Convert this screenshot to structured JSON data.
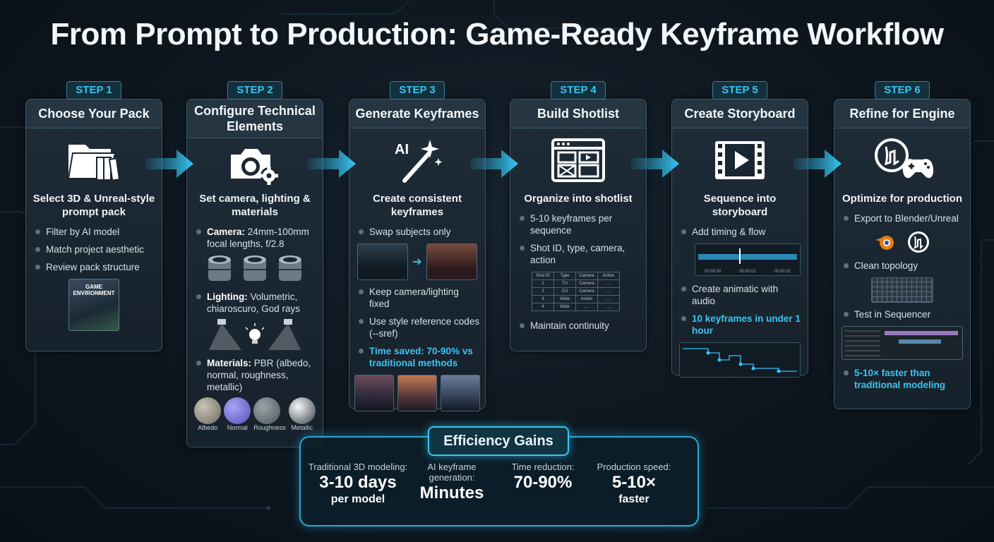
{
  "title": "From Prompt to Production: Game-Ready Keyframe Workflow",
  "colors": {
    "accent": "#38c6f2",
    "card": "#1a2632",
    "border": "#3b5466"
  },
  "steps": [
    {
      "badge": "STEP 1",
      "heading": "Choose Your Pack",
      "icon": "folder-icon",
      "subheading": "Select 3D & Unreal-style prompt pack",
      "bullets": [
        "Filter by AI model",
        "Match project aesthetic",
        "Review pack structure"
      ],
      "pack_cover_title": "GAME ENVIRONMENT"
    },
    {
      "badge": "STEP 2",
      "heading": "Configure Technical Elements",
      "icon": "camera-gear-icon",
      "subheading": "Set camera, lighting & materials",
      "camera_label": "Camera:",
      "camera_text": "24mm-100mm focal lengths, f/2.8",
      "lighting_label": "Lighting:",
      "lighting_text": "Volumetric, chiaroscuro, God rays",
      "materials_label": "Materials:",
      "materials_text": "PBR (albedo, normal, roughness, metallic)",
      "material_swatches": [
        "Albedo",
        "Normal",
        "Roughness",
        "Metallic"
      ]
    },
    {
      "badge": "STEP 3",
      "heading": "Generate Keyframes",
      "icon": "ai-magic-wand-icon",
      "icon_text": "AI",
      "subheading": "Create consistent keyframes",
      "bullets": [
        "Swap subjects only",
        "Keep camera/lighting fixed",
        "Use style reference codes (--sref)"
      ],
      "highlight": "Time saved: 70-90% vs traditional methods"
    },
    {
      "badge": "STEP 4",
      "heading": "Build Shotlist",
      "icon": "shotlist-layout-icon",
      "subheading": "Organize into shotlist",
      "bullets": [
        "5-10 keyframes per sequence",
        "Shot ID, type, camera, action"
      ],
      "table_headers": [
        "Shot ID",
        "Type",
        "Camera",
        "Action"
      ],
      "table_rows": [
        [
          "1",
          "TU",
          "Camera",
          "..."
        ],
        [
          "2",
          "CU",
          "Camera",
          "..."
        ],
        [
          "3",
          "Wide",
          "Action",
          "..."
        ],
        [
          "4",
          "Wide",
          "...",
          "..."
        ]
      ],
      "last_bullet": "Maintain continuity"
    },
    {
      "badge": "STEP 5",
      "heading": "Create Storyboard",
      "icon": "film-play-icon",
      "subheading": "Sequence into storyboard",
      "bullets": [
        "Add timing & flow",
        "Create animatic with audio"
      ],
      "timeline_labels": [
        "00:00:00",
        "00:00:01",
        "00:00:02"
      ],
      "highlight": "10 keyframes in under 1 hour"
    },
    {
      "badge": "STEP 6",
      "heading": "Refine for Engine",
      "icon": "unreal-gamepad-icon",
      "subheading": "Optimize for production",
      "bullets": [
        "Export to Blender/Unreal",
        "Clean topology",
        "Test in Sequencer"
      ],
      "highlight": "5-10× faster than traditional modeling"
    }
  ],
  "efficiency": {
    "title": "Efficiency Gains",
    "stats": [
      {
        "label": "Traditional 3D modeling:",
        "value": "3-10 days",
        "unit": "per model"
      },
      {
        "label": "AI keyframe generation:",
        "value": "Minutes",
        "unit": ""
      },
      {
        "label": "Time reduction:",
        "value": "70-90%",
        "unit": ""
      },
      {
        "label": "Production speed:",
        "value": "5-10×",
        "unit": "faster"
      }
    ]
  }
}
